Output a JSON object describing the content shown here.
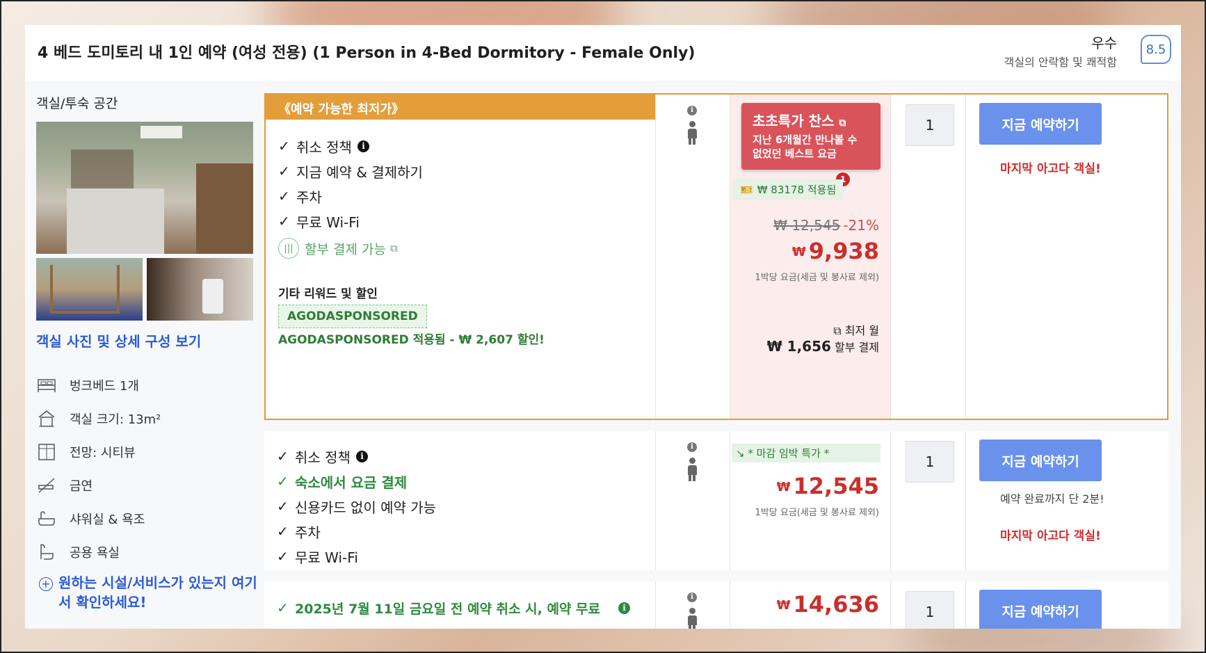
{
  "room": {
    "title": "4 베드 도미토리 내 1인 예약 (여성 전용) (1 Person in 4-Bed Dormitory - Female Only)",
    "score_label": "우수",
    "score_desc": "객실의 안락함 및 쾌적함",
    "score": "8.5"
  },
  "left": {
    "heading": "객실/투숙 공간",
    "photos_link": "객실 사진 및 상세 구성 보기",
    "features": [
      {
        "icon": "bed-icon",
        "label": "벙크베드 1개"
      },
      {
        "icon": "house-icon",
        "label": "객실 크기: 13m²"
      },
      {
        "icon": "window-icon",
        "label": "전망: 시티뷰"
      },
      {
        "icon": "no-smoking-icon",
        "label": "금연"
      },
      {
        "icon": "bathtub-icon",
        "label": "샤워실 & 욕조"
      },
      {
        "icon": "shared-bath-icon",
        "label": "공용 욕실"
      }
    ],
    "facility_link": "원하는 시설/서비스가 있는지 여기서 확인하세요!"
  },
  "offers": [
    {
      "banner": "《예약 가능한 최저가》",
      "inclusions": [
        "취소 정책",
        "지금 예약 & 결제하기",
        "주차",
        "무료 Wi-Fi"
      ],
      "installment_label": "할부 결제 가능",
      "rewards_heading": "기타 리워드 및 할인",
      "promo_tag": "AGODASPONSORED",
      "promo_text": "AGODASPONSORED 적용됨 - ₩ 2,607 할인!",
      "deal_title": "초초특가 찬스",
      "deal_sub": "지난 6개월간 만나볼 수 없었던 베스트 요금",
      "coupon": "₩ 83178 적용됨",
      "coupon_count": "1",
      "original_price": "₩ 12,545",
      "discount": "-21%",
      "currency": "₩",
      "price": "9,938",
      "per_night": "1박당 요금(세금 및 봉사료 제외)",
      "installment_min": "최저 월",
      "installment_amount": "₩ 1,656",
      "installment_suffix": "할부 결제",
      "quantity": "1",
      "book_label": "지금 예약하기",
      "urgency": "마지막 아고다 객실!"
    },
    {
      "inclusions": [
        "취소 정책",
        "숙소에서 요금 결제",
        "신용카드 없이 예약 가능",
        "주차",
        "무료 Wi-Fi"
      ],
      "last_minute": "↘ * 마감 임박 특가 *",
      "currency": "₩",
      "price": "12,545",
      "per_night": "1박당 요금(세금 및 봉사료 제외)",
      "quantity": "1",
      "book_label": "지금 예약하기",
      "note": "예약 완료까지 단 2분!",
      "urgency": "마지막 아고다 객실!"
    },
    {
      "cancel_text": "2025년 7월 11일 금요일 전 예약 취소 시, 예약 무료",
      "currency": "₩",
      "price": "14,636",
      "quantity": "1",
      "book_label": "지금 예약하기"
    }
  ]
}
